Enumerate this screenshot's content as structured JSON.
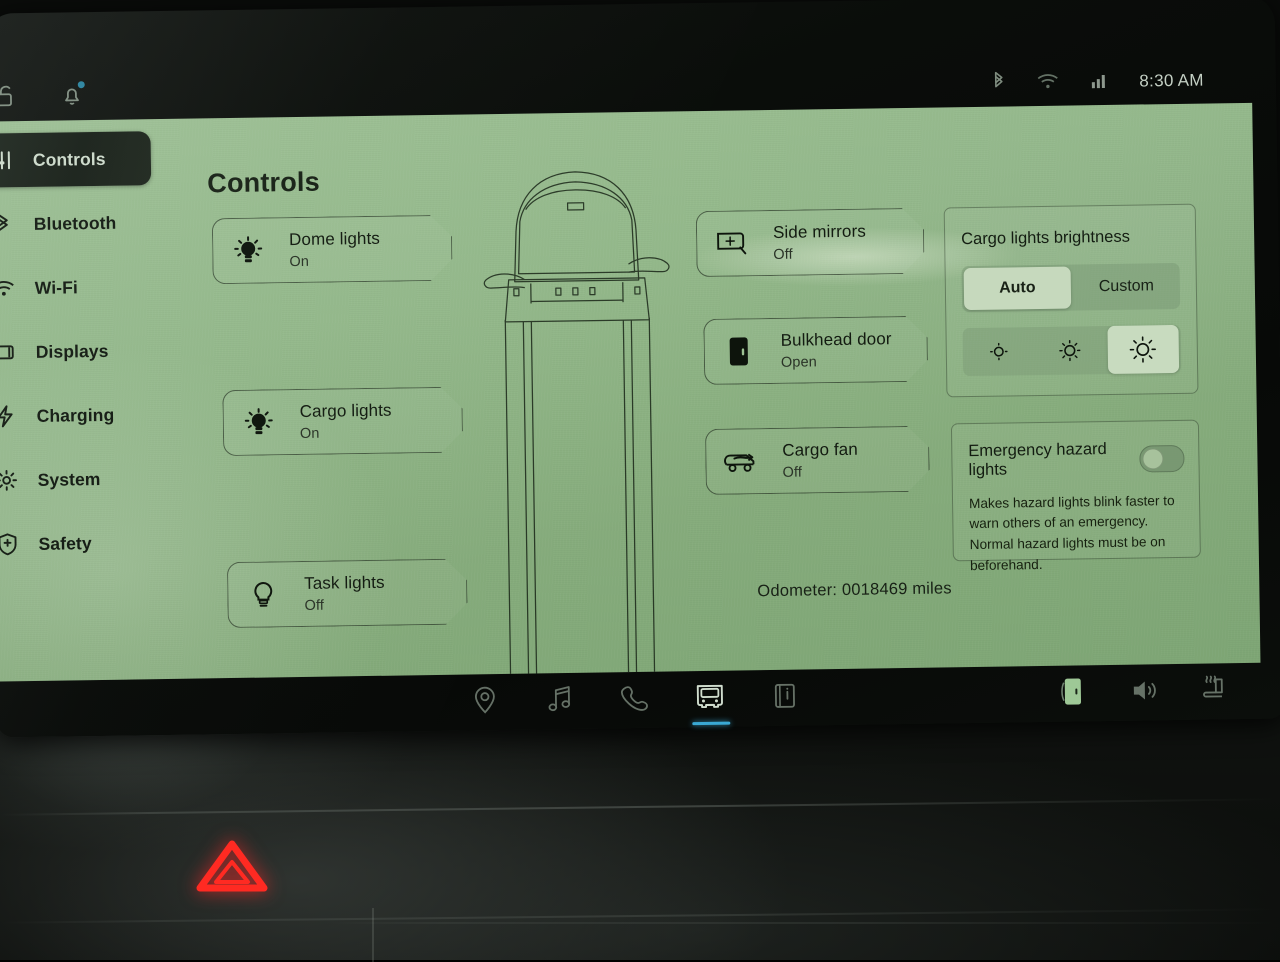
{
  "statusbar": {
    "time": "8:30 AM",
    "left_icons": [
      "unlock-icon",
      "notification-bell-icon"
    ],
    "right_icons": [
      "bluetooth-icon",
      "wifi-icon",
      "cellular-signal-icon"
    ]
  },
  "sidebar": {
    "items": [
      {
        "label": "Controls",
        "icon": "sliders-icon",
        "selected": true
      },
      {
        "label": "Bluetooth",
        "icon": "bluetooth-icon",
        "selected": false
      },
      {
        "label": "Wi-Fi",
        "icon": "wifi-icon",
        "selected": false
      },
      {
        "label": "Displays",
        "icon": "display-icon",
        "selected": false
      },
      {
        "label": "Charging",
        "icon": "bolt-icon",
        "selected": false
      },
      {
        "label": "System",
        "icon": "gear-icon",
        "selected": false
      },
      {
        "label": "Safety",
        "icon": "shield-plus-icon",
        "selected": false
      }
    ]
  },
  "main": {
    "title": "Controls",
    "odometer": "Odometer: 0018469 miles",
    "vehicle_graphic": "van-top-view",
    "tiles_left": [
      {
        "name": "Dome lights",
        "state": "On",
        "icon": "lightbulb-on-icon"
      },
      {
        "name": "Cargo lights",
        "state": "On",
        "icon": "lightbulb-on-icon"
      },
      {
        "name": "Task lights",
        "state": "Off",
        "icon": "lightbulb-off-icon"
      }
    ],
    "tiles_middle": [
      {
        "name": "Side mirrors",
        "state": "Off",
        "icon": "side-mirror-icon"
      },
      {
        "name": "Bulkhead door",
        "state": "Open",
        "icon": "bulkhead-door-icon"
      },
      {
        "name": "Cargo fan",
        "state": "Off",
        "icon": "cargo-fan-icon"
      }
    ]
  },
  "brightness_panel": {
    "title": "Cargo lights brightness",
    "mode_options": [
      "Auto",
      "Custom"
    ],
    "mode_selected": "Auto",
    "levels": [
      "low",
      "medium",
      "high"
    ],
    "level_selected": "high"
  },
  "hazard_panel": {
    "title": "Emergency hazard lights",
    "description": "Makes hazard lights blink faster to warn others of an emergency. Normal hazard lights must be on beforehand.",
    "toggle_state": "off"
  },
  "dock": {
    "center_items": [
      {
        "icon": "location-pin-icon",
        "active": false
      },
      {
        "icon": "music-note-icon",
        "active": false
      },
      {
        "icon": "phone-icon",
        "active": false
      },
      {
        "icon": "truck-icon",
        "active": true
      },
      {
        "icon": "manual-book-icon",
        "active": false
      }
    ],
    "right_items": [
      {
        "icon": "bulkhead-door-icon",
        "active": true
      },
      {
        "icon": "volume-icon",
        "active": false
      },
      {
        "icon": "heated-seat-icon",
        "active": false
      }
    ]
  },
  "dashboard": {
    "hazard_button": "hazard-warning-triangle-button",
    "hazard_color": "#ff2a22",
    "defrost_buttons": [
      "rear-defrost-icon",
      "front-defrost-icon"
    ]
  },
  "colors": {
    "screen_bg": "#8fb486",
    "bezel": "#0a0d0a",
    "accent_blue": "#3aa9d4",
    "text_dark": "#141d12",
    "selected_pill": "#c6d9bd"
  }
}
